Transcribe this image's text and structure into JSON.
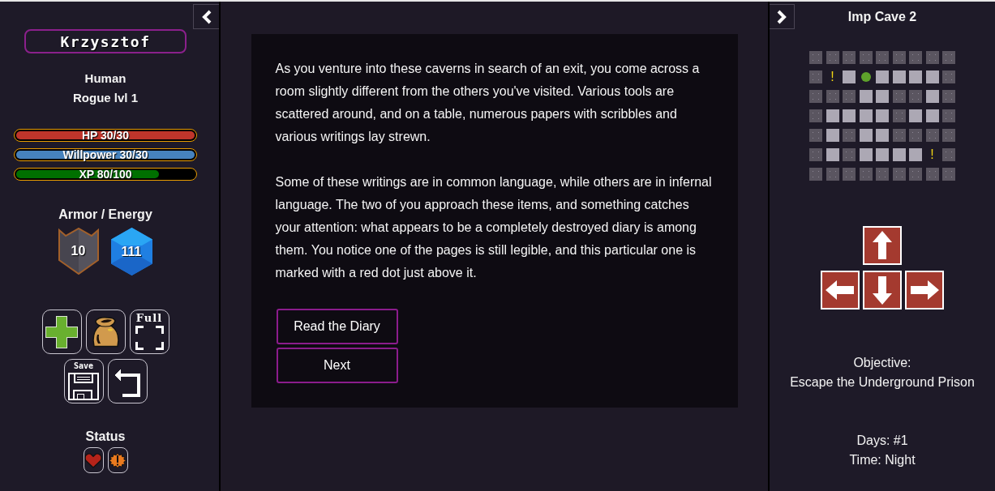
{
  "character": {
    "name": "Krzysztof",
    "race": "Human",
    "class_level": "Rogue lvl 1",
    "bars": [
      {
        "label": "HP 30/30",
        "level": 1,
        "color": "#c0352b"
      },
      {
        "label": "Willpower 30/30",
        "level": 1,
        "color": "#4682bd"
      },
      {
        "label": "XP 80/100",
        "level": 0.8,
        "color": "#007000"
      }
    ],
    "defense": {
      "title": "Armor / Energy",
      "armor": "10",
      "energy": "111"
    },
    "actions": [
      [
        {
          "kind": "heal"
        },
        {
          "kind": "bag"
        },
        {
          "kind": "fullscreen",
          "label": "Full"
        }
      ],
      [
        {
          "kind": "save",
          "label": "Save"
        },
        {
          "kind": "undo"
        }
      ]
    ],
    "status": {
      "title": "Status",
      "effects": [
        {
          "kind": "heart"
        },
        {
          "kind": "alert"
        }
      ]
    }
  },
  "story": {
    "paragraphs": [
      "As you venture into these caverns in search of an exit, you come across a room slightly different from the others you've visited. Various tools are scattered around, and on a table, numerous papers with scribbles and various writings lay strewn.",
      "Some of these writings are in common language, while others are in infernal language. The two of you approach these items, and something catches your attention: what appears to be a completely destroyed diary is among them. You notice one of the pages is still legible, and this particular one is marked with a red dot just above it."
    ],
    "choices": [
      "Read the Diary",
      "Next"
    ]
  },
  "location": {
    "title": "Imp Cave 2",
    "map": [
      [
        {
          "kind": "wall"
        },
        {
          "kind": "wall"
        },
        {
          "kind": "wall"
        },
        {
          "kind": "wall"
        },
        {
          "kind": "wall"
        },
        {
          "kind": "wall"
        },
        {
          "kind": "wall"
        },
        {
          "kind": "wall"
        },
        {
          "kind": "wall"
        }
      ],
      [
        {
          "kind": "wall"
        },
        {
          "kind": "event",
          "label": "!"
        },
        {
          "kind": "floor"
        },
        {
          "kind": "player"
        },
        {
          "kind": "floor"
        },
        {
          "kind": "floor"
        },
        {
          "kind": "floor"
        },
        {
          "kind": "floor"
        },
        {
          "kind": "wall"
        }
      ],
      [
        {
          "kind": "wall"
        },
        {
          "kind": "wall"
        },
        {
          "kind": "wall"
        },
        {
          "kind": "floor"
        },
        {
          "kind": "floor"
        },
        {
          "kind": "wall"
        },
        {
          "kind": "wall"
        },
        {
          "kind": "floor"
        },
        {
          "kind": "wall"
        }
      ],
      [
        {
          "kind": "wall"
        },
        {
          "kind": "floor"
        },
        {
          "kind": "floor"
        },
        {
          "kind": "floor"
        },
        {
          "kind": "floor"
        },
        {
          "kind": "wall"
        },
        {
          "kind": "floor"
        },
        {
          "kind": "floor"
        },
        {
          "kind": "wall"
        }
      ],
      [
        {
          "kind": "wall"
        },
        {
          "kind": "floor"
        },
        {
          "kind": "wall"
        },
        {
          "kind": "floor"
        },
        {
          "kind": "floor"
        },
        {
          "kind": "wall"
        },
        {
          "kind": "wall"
        },
        {
          "kind": "wall"
        },
        {
          "kind": "wall"
        }
      ],
      [
        {
          "kind": "wall"
        },
        {
          "kind": "floor"
        },
        {
          "kind": "wall"
        },
        {
          "kind": "floor"
        },
        {
          "kind": "floor"
        },
        {
          "kind": "floor"
        },
        {
          "kind": "floor"
        },
        {
          "kind": "event",
          "label": "!"
        },
        {
          "kind": "wall"
        }
      ],
      [
        {
          "kind": "wall"
        },
        {
          "kind": "wall"
        },
        {
          "kind": "wall"
        },
        {
          "kind": "wall"
        },
        {
          "kind": "wall"
        },
        {
          "kind": "wall"
        },
        {
          "kind": "wall"
        },
        {
          "kind": "wall"
        },
        {
          "kind": "wall"
        }
      ]
    ]
  },
  "objective": {
    "title": "Objective:",
    "text": "Escape the Underground Prison"
  },
  "calendar": {
    "days": "Days: #1",
    "time": "Time: Night"
  }
}
